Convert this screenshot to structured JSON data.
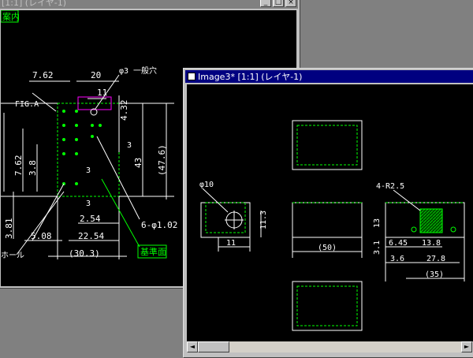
{
  "window_back": {
    "title": "[1:1] (レイヤ-1)",
    "guide_label": "案内",
    "dims": {
      "d7_62_top": "7.62",
      "d20": "20",
      "d11": "11",
      "phi3": "φ3 一般穴",
      "d4_32": "4.32",
      "fig": "FIG.A",
      "d7_62_side": "7.62",
      "d3_8": "3.8",
      "d3_a": "3",
      "d3_b": "3",
      "d3_c": "3",
      "d43": "43",
      "d47_6": "(47.6)",
      "d3_81": "3.81",
      "d2_54": "2.54",
      "d6phi": "6-φ1.02",
      "d5_08": "5.08",
      "d22_54": "22.54",
      "d30_3": "(30.3)",
      "hole": "ホール",
      "ref_label": "基準面"
    }
  },
  "window_front": {
    "title": "Image3* [1:1] (レイヤ-1)",
    "dims": {
      "phi10": "φ10",
      "d11_3": "11.3",
      "d11": "11",
      "d50": "(50)",
      "r2_5": "4-R2.5",
      "d13": "13",
      "d3_1": "3.1",
      "d6_45": "6.45",
      "d13_8": "13.8",
      "d3_6": "3.6",
      "d27_8": "27.8",
      "d35": "(35)"
    }
  },
  "controls": {
    "minimize": "_",
    "maximize": "□",
    "close": "×",
    "scroll_left": "◄",
    "scroll_right": "►"
  },
  "colors": {
    "cad_background": "#000000",
    "geometry": "#ffffff",
    "hidden_lines": "#00ff00",
    "label_box": "#00ff00",
    "hatch": "#00cc00",
    "titlebar_active": "#000080"
  }
}
